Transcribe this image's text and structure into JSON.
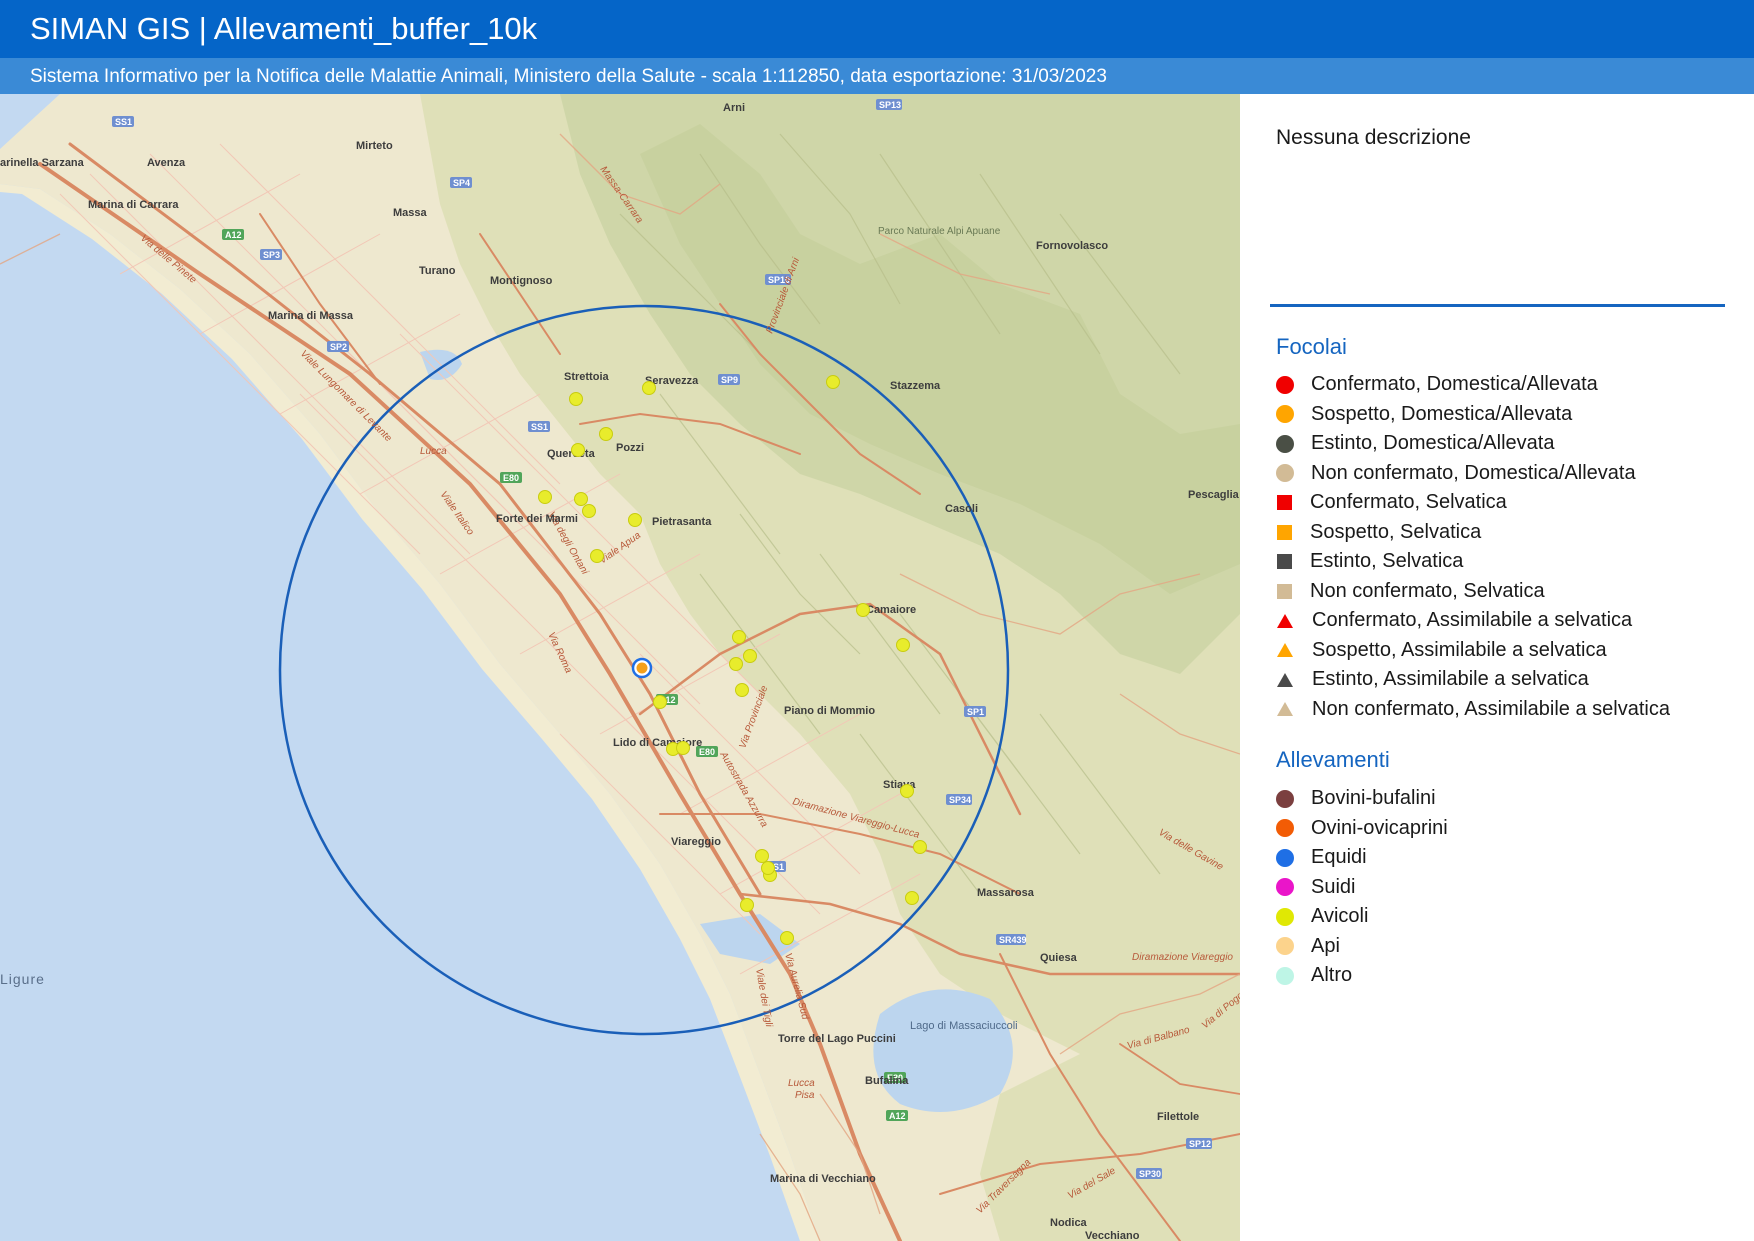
{
  "header": {
    "title": "SIMAN GIS | Allevamenti_buffer_10k",
    "subtitle": "Sistema Informativo per la Notifica delle Malattie Animali, Ministero della Salute - scala 1:112850, data esportazione: 31/03/2023"
  },
  "map": {
    "places": [
      "Arni",
      "Mirteto",
      "Avenza",
      "arinella Sarzana",
      "Marina di Carrara",
      "Massa",
      "Turano",
      "Montignoso",
      "Marina di Massa",
      "Strettoia",
      "Seravezza",
      "Stazzema",
      "Querceta",
      "Pozzi",
      "Forte dei Marmi",
      "Pietrasanta",
      "Casoli",
      "Pescaglia",
      "Camaiore",
      "Piano di Mommio",
      "Lido di Camaiore",
      "Stiava",
      "Viareggio",
      "Massarosa",
      "Quiesa",
      "Torre del Lago Puccini",
      "Lago di Massaciuccoli",
      "Bufalina",
      "Filettole",
      "Marina di Vecchiano",
      "Nodica",
      "Vecchiano",
      "Fornovolasco",
      "Parco Naturale Alpi Apuane",
      "Ligure"
    ],
    "roads": [
      "Autostrada Azzurra",
      "Via degli Ontani",
      "Viale Apua",
      "Via Provinciale",
      "Diramazione Viareggio-Lucca",
      "Via delle Gavine",
      "Diramazione Viareggio",
      "Via di Balbano",
      "Via Aurelia Sud",
      "Viale dei Tigli",
      "Via Traversagna",
      "Via del Sale",
      "Via Roma",
      "Viale Italico",
      "Via delle Pinete",
      "Viale Lungomare di Levante",
      "Massa-Carrara",
      "Provinciale di Arni",
      "Lucca",
      "Pisa",
      "Via di Poggio"
    ],
    "shields": [
      "SS1",
      "SP13",
      "SP4",
      "A12",
      "SP3",
      "SP10",
      "SP2",
      "SP9",
      "E80",
      "SP1",
      "SP34",
      "SR439",
      "SP12",
      "SP30"
    ],
    "buffer_radius_km": 10,
    "center_symbol": "Ovini-ovicaprini / Equidi",
    "avicoli_point_count": 27
  },
  "legend": {
    "description": "Nessuna descrizione",
    "focolai_title": "Focolai",
    "focolai": [
      {
        "label": "Confermato, Domestica/Allevata",
        "shape": "circle",
        "color": "#f00000"
      },
      {
        "label": "Sospetto, Domestica/Allevata",
        "shape": "circle",
        "color": "#ffa500"
      },
      {
        "label": "Estinto, Domestica/Allevata",
        "shape": "circle",
        "color": "#4a4f45"
      },
      {
        "label": "Non confermato, Domestica/Allevata",
        "shape": "circle",
        "color": "#d2bb96"
      },
      {
        "label": "Confermato, Selvatica",
        "shape": "square",
        "color": "#f00000"
      },
      {
        "label": "Sospetto, Selvatica",
        "shape": "square",
        "color": "#ffa500"
      },
      {
        "label": "Estinto, Selvatica",
        "shape": "square",
        "color": "#4a4a4a"
      },
      {
        "label": "Non confermato, Selvatica",
        "shape": "square",
        "color": "#d2bb96"
      },
      {
        "label": "Confermato, Assimilabile a selvatica",
        "shape": "triangle",
        "color": "#f00000"
      },
      {
        "label": "Sospetto, Assimilabile a selvatica",
        "shape": "triangle",
        "color": "#ffa500"
      },
      {
        "label": "Estinto, Assimilabile a selvatica",
        "shape": "triangle",
        "color": "#4a4a4a"
      },
      {
        "label": "Non confermato, Assimilabile a selvatica",
        "shape": "triangle",
        "color": "#d2bb96"
      }
    ],
    "allevamenti_title": "Allevamenti",
    "allevamenti": [
      {
        "label": "Bovini-bufalini",
        "shape": "circle",
        "color": "#7b3f3f"
      },
      {
        "label": "Ovini-ovicaprini",
        "shape": "circle",
        "color": "#f25c05"
      },
      {
        "label": "Equidi",
        "shape": "circle",
        "color": "#1f6fe5"
      },
      {
        "label": "Suidi",
        "shape": "circle",
        "color": "#ea15c9"
      },
      {
        "label": "Avicoli",
        "shape": "circle",
        "color": "#e0e804"
      },
      {
        "label": "Api",
        "shape": "circle",
        "color": "#fcd38c"
      },
      {
        "label": "Altro",
        "shape": "circle",
        "color": "#bef5e6"
      }
    ]
  }
}
